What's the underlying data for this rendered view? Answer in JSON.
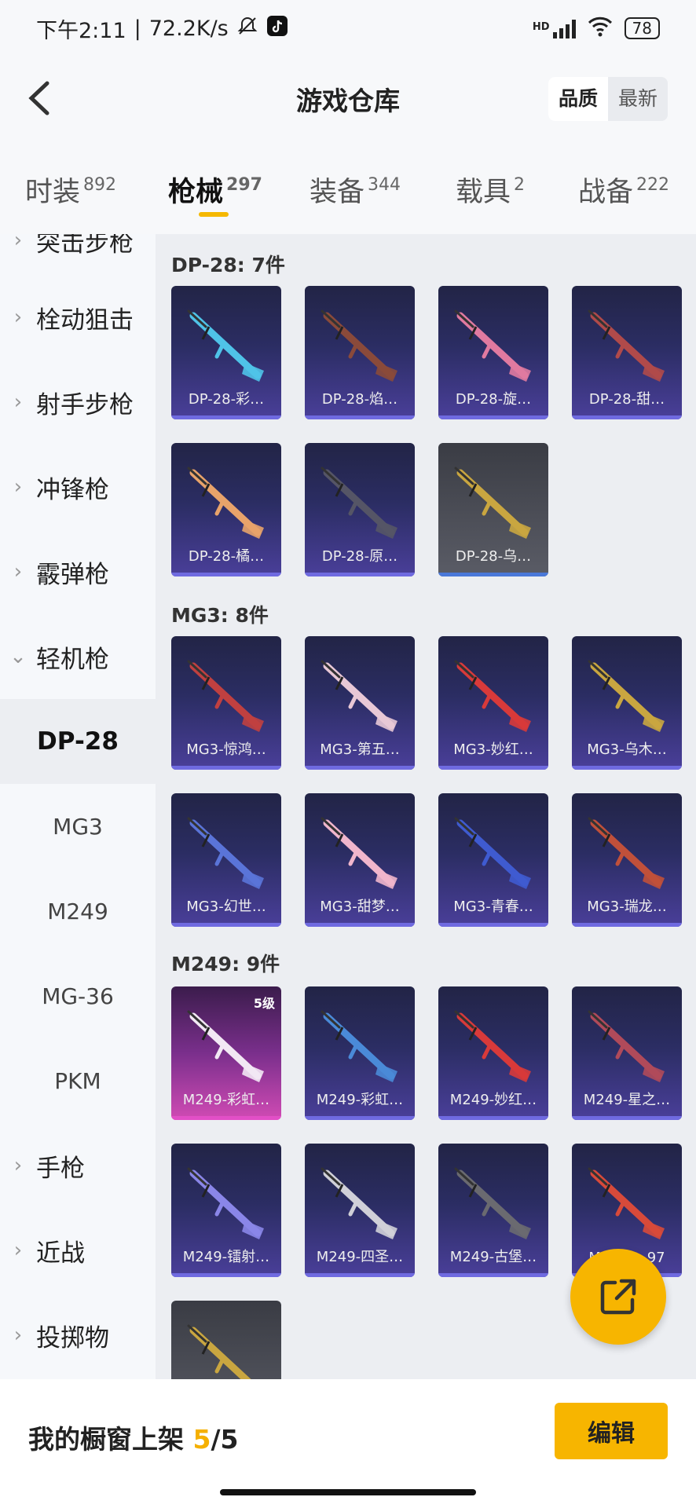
{
  "status_bar": {
    "time": "下午2:11",
    "speed": "72.2K/s",
    "hd": "HD",
    "battery": "78",
    "icons": [
      "mute-icon",
      "tiktok-icon",
      "signal-icon",
      "wifi-icon",
      "battery-icon"
    ]
  },
  "header": {
    "back_icon": "back-arrow-icon",
    "title": "游戏仓库",
    "sort_options": [
      "品质",
      "最新"
    ],
    "sort_selected": "品质"
  },
  "category_tabs": [
    {
      "label": "时装",
      "count": "892"
    },
    {
      "label": "枪械",
      "count": "297",
      "active": true
    },
    {
      "label": "装备",
      "count": "344"
    },
    {
      "label": "载具",
      "count": "2"
    },
    {
      "label": "战备",
      "count": "222"
    }
  ],
  "sidebar": {
    "items": [
      {
        "label": "突击步枪",
        "partial": true
      },
      {
        "label": "栓动狙击"
      },
      {
        "label": "射手步枪"
      },
      {
        "label": "冲锋枪"
      },
      {
        "label": "霰弹枪"
      },
      {
        "label": "轻机枪",
        "expanded": true
      },
      {
        "label": "手枪"
      },
      {
        "label": "近战"
      },
      {
        "label": "投掷物"
      }
    ],
    "sub_items": [
      {
        "label": "DP-28",
        "active": true
      },
      {
        "label": "MG3"
      },
      {
        "label": "M249"
      },
      {
        "label": "MG-36"
      },
      {
        "label": "PKM"
      }
    ]
  },
  "groups": [
    {
      "title": "DP-28: 7件",
      "cards": [
        {
          "label": "DP-28-彩…",
          "gun_color": "#4fc3e8"
        },
        {
          "label": "DP-28-焰…",
          "gun_color": "#8a4a3a"
        },
        {
          "label": "DP-28-旋…",
          "gun_color": "#e07aa0"
        },
        {
          "label": "DP-28-甜…",
          "gun_color": "#b04a4a"
        },
        {
          "label": "DP-28-橘…",
          "gun_color": "#e8a36a"
        },
        {
          "label": "DP-28-原…",
          "gun_color": "#555566"
        },
        {
          "label": "DP-28-乌…",
          "gun_color": "#c9a640",
          "grey": true
        }
      ]
    },
    {
      "title": "MG3: 8件",
      "cards": [
        {
          "label": "MG3-惊鸿…",
          "gun_color": "#c04040"
        },
        {
          "label": "MG3-第五…",
          "gun_color": "#e8c8d6"
        },
        {
          "label": "MG3-妙红…",
          "gun_color": "#d83a3a"
        },
        {
          "label": "MG3-乌木…",
          "gun_color": "#c9a640"
        },
        {
          "label": "MG3-幻世…",
          "gun_color": "#5a74d8"
        },
        {
          "label": "MG3-甜梦…",
          "gun_color": "#f0b6cc"
        },
        {
          "label": "MG3-青春…",
          "gun_color": "#3f5bd0"
        },
        {
          "label": "MG3-瑞龙…",
          "gun_color": "#c0503a"
        }
      ]
    },
    {
      "title": "M249: 9件",
      "cards": [
        {
          "label": "M249-彩虹…",
          "gun_color": "#f2e8f4",
          "pink": true,
          "badge": "5级"
        },
        {
          "label": "M249-彩虹…",
          "gun_color": "#4a8ad8"
        },
        {
          "label": "M249-妙红…",
          "gun_color": "#d83a3a"
        },
        {
          "label": "M249-星之…",
          "gun_color": "#b04a5a"
        },
        {
          "label": "M249-镭射…",
          "gun_color": "#8a86e8"
        },
        {
          "label": "M249-四圣…",
          "gun_color": "#d0d0d8"
        },
        {
          "label": "M249-古堡…",
          "gun_color": "#6a6a70"
        },
        {
          "label": "M249-…97",
          "gun_color": "#d84a3a"
        },
        {
          "label": "",
          "gun_color": "#c9a640",
          "grey": true
        }
      ]
    }
  ],
  "fab": {
    "icon": "share-external-icon"
  },
  "bottom": {
    "shelf_label": "我的橱窗上架",
    "shelf_count": "5",
    "shelf_sep": "/",
    "shelf_total": "5",
    "edit_label": "编辑"
  }
}
